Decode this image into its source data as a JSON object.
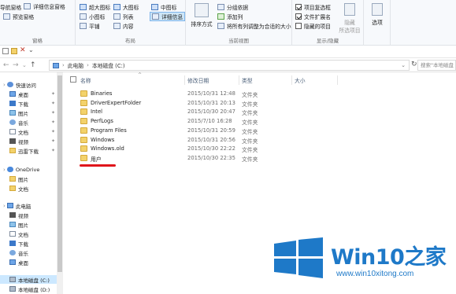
{
  "ribbon": {
    "pane": {
      "items": [
        "导航窗格",
        "预览窗格",
        "详细信息窗格"
      ],
      "label": "窗格"
    },
    "layout": {
      "items": [
        "超大图标",
        "大图标",
        "中图标",
        "小图标",
        "列表",
        "详细信息",
        "平铺",
        "内容"
      ],
      "label": "布局",
      "selected": "详细信息"
    },
    "current_view": {
      "sort_label": "排序方式",
      "group_by": "分组依据",
      "add_column": "添加列",
      "fit_columns": "将所有列调整为合适的大小",
      "label": "当前视图"
    },
    "show_hide": {
      "item_checkboxes": "项目复选框",
      "file_extensions": "文件扩展名",
      "hidden_items": "隐藏的项目",
      "hide_selected_1": "隐藏",
      "hide_selected_2": "所选项目",
      "label": "显示/隐藏",
      "checks": {
        "item_checkboxes": true,
        "file_extensions": true,
        "hidden_items": false
      }
    },
    "options": {
      "label": "选项"
    }
  },
  "address": {
    "path": [
      "此电脑",
      "本地磁盘 (C:)"
    ],
    "search_placeholder": "搜索\"本地磁盘 (C:)\""
  },
  "nav": {
    "items": [
      {
        "label": "快速访问",
        "icon": "star-icon"
      },
      {
        "label": "桌面",
        "icon": "desktop-icon",
        "pinned": true
      },
      {
        "label": "下载",
        "icon": "download-icon",
        "pinned": true
      },
      {
        "label": "图片",
        "icon": "pictures-icon",
        "pinned": true
      },
      {
        "label": "音乐",
        "icon": "music-icon",
        "pinned": true
      },
      {
        "label": "文档",
        "icon": "documents-icon",
        "pinned": true
      },
      {
        "label": "视频",
        "icon": "videos-icon",
        "pinned": true
      },
      {
        "label": "迅雷下载",
        "icon": "folder-icon",
        "pinned": true
      },
      {
        "label": "OneDrive",
        "icon": "onedrive-icon"
      },
      {
        "label": "图片",
        "icon": "folder-icon"
      },
      {
        "label": "文档",
        "icon": "folder-icon"
      },
      {
        "label": "此电脑",
        "icon": "this-pc-icon"
      },
      {
        "label": "视频",
        "icon": "videos-icon"
      },
      {
        "label": "图片",
        "icon": "pictures-icon"
      },
      {
        "label": "文档",
        "icon": "documents-icon"
      },
      {
        "label": "下载",
        "icon": "download-icon"
      },
      {
        "label": "音乐",
        "icon": "music-icon"
      },
      {
        "label": "桌面",
        "icon": "desktop-icon"
      },
      {
        "label": "本地磁盘 (C:)",
        "icon": "local-disk-icon",
        "selected": true
      },
      {
        "label": "本地磁盘 (D:)",
        "icon": "local-disk-icon"
      }
    ]
  },
  "list": {
    "columns": [
      "名称",
      "修改日期",
      "类型",
      "大小"
    ],
    "rows": [
      {
        "name": "Binaries",
        "date": "2015/10/31 12:48",
        "type": "文件夹"
      },
      {
        "name": "DriverExpertFolder",
        "date": "2015/10/31 20:13",
        "type": "文件夹"
      },
      {
        "name": "Intel",
        "date": "2015/10/30 20:47",
        "type": "文件夹"
      },
      {
        "name": "PerfLogs",
        "date": "2015/7/10 16:28",
        "type": "文件夹"
      },
      {
        "name": "Program Files",
        "date": "2015/10/31 20:59",
        "type": "文件夹"
      },
      {
        "name": "Windows",
        "date": "2015/10/31 20:56",
        "type": "文件夹"
      },
      {
        "name": "Windows.old",
        "date": "2015/10/30 22:22",
        "type": "文件夹"
      },
      {
        "name": "用户",
        "date": "2015/10/30 22:35",
        "type": "文件夹"
      }
    ]
  },
  "watermark": {
    "title": "Win10之家",
    "url": "www.win10xitong.com",
    "logo_color": "#1e79c8"
  }
}
